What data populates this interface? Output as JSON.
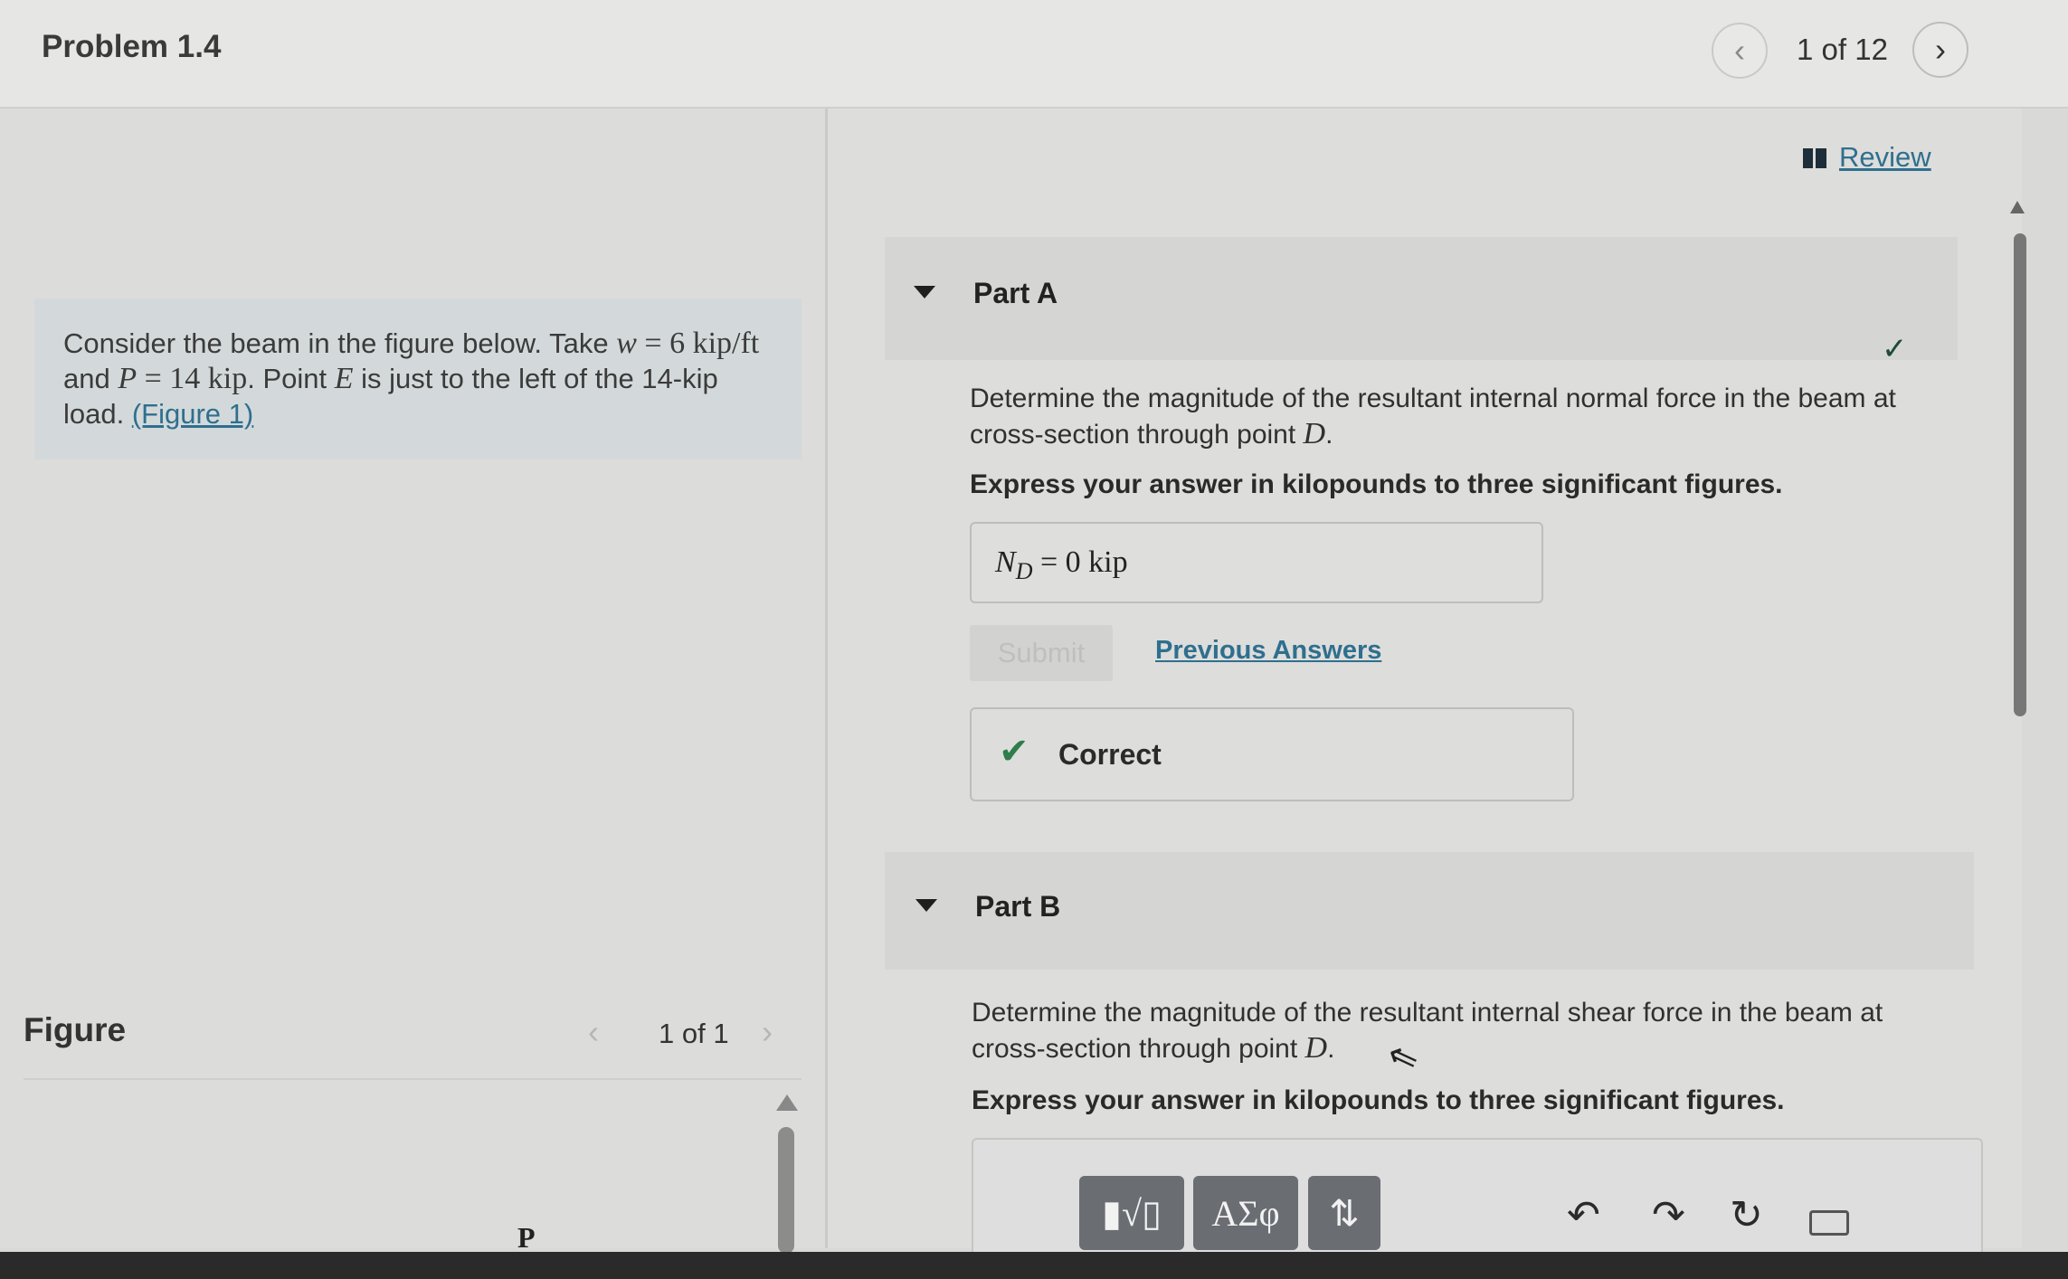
{
  "header": {
    "title": "Problem 1.4",
    "page_count": "1 of 12",
    "prev_icon": "chevron-left-icon",
    "next_icon": "chevron-right-icon"
  },
  "problem": {
    "text_1": "Consider the beam in the figure below. Take ",
    "w_sym": "w",
    "w_val": " = 6 kip/ft",
    "text_2": "and ",
    "p_sym": "P",
    "p_val": " = 14 kip",
    "text_3": ". Point ",
    "e_sym": "E",
    "text_4": " is just to the left of the 14-kip load. ",
    "figure_link": "(Figure 1)"
  },
  "figure": {
    "label": "Figure",
    "page_count": "1 of 1",
    "load_label": "P"
  },
  "review": {
    "label": "Review",
    "icon": "book-icon"
  },
  "part_a": {
    "title": "Part A",
    "question_1": "Determine the magnitude of the resultant internal normal force in the beam at",
    "question_2": "cross-section through point ",
    "point": "D",
    "instruction": "Express your answer in kilopounds to three significant figures.",
    "answer_sym": "N",
    "answer_sub": "D",
    "answer_value": " = 0  kip",
    "submit_label": "Submit",
    "previous_answers_label": "Previous Answers",
    "feedback": "Correct"
  },
  "part_b": {
    "title": "Part B",
    "question_1": "Determine the magnitude of the resultant internal shear force in the beam at",
    "question_2": "cross-section through point ",
    "point": "D",
    "instruction": "Express your answer in kilopounds to three significant figures.",
    "toolbar": {
      "templates_label": "▮√▯",
      "greek_label": "ΑΣφ",
      "arrows_label": "⇅",
      "undo_icon": "undo-icon",
      "redo_icon": "redo-icon",
      "reset_icon": "reset-icon",
      "keyboard_icon": "keyboard-icon"
    }
  },
  "colors": {
    "link": "#2f6f8e",
    "correct_green": "#2e7d4a",
    "toolbar_button": "#6a6d72"
  }
}
